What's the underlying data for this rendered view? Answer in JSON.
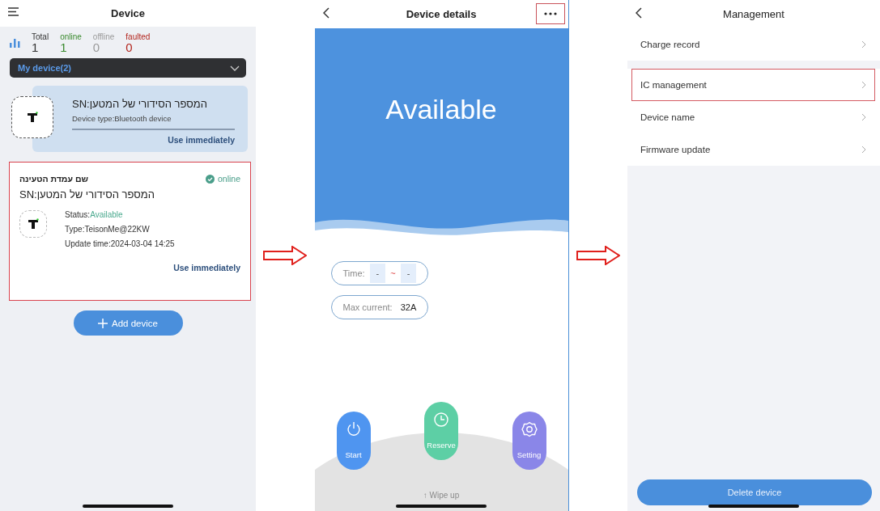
{
  "device_list": {
    "title": "Device",
    "stats": [
      {
        "label": "Total",
        "value": "1",
        "color": "#333333"
      },
      {
        "label": "online",
        "value": "1",
        "color": "#3a8a2e"
      },
      {
        "label": "offline",
        "value": "0",
        "color": "#9a9a9a"
      },
      {
        "label": "faulted",
        "value": "0",
        "color": "#b3261e"
      }
    ],
    "dropdown": {
      "label": "My device(2)"
    },
    "devices": [
      {
        "kind": "bluetooth",
        "sn": "SN:המספר הסידורי של המטען",
        "type": "Device type:Bluetooth device",
        "action": "Use immediately",
        "highlighted": false
      },
      {
        "kind": "charger",
        "name": "שם עמדת הטעינה",
        "badge": "online",
        "sn": "SN:המספר הסידורי של המטען",
        "status_label": "Status:",
        "status_value": "Available",
        "type": "Type:TeisonMe@22KW",
        "update": "Update time:2024-03-04 14:25",
        "action": "Use immediately",
        "highlighted": true
      }
    ],
    "add_button": "Add device"
  },
  "device_details": {
    "title": "Device details",
    "more_highlighted": true,
    "status": "Available",
    "time": {
      "label": "Time:",
      "start": "-",
      "separator": "~",
      "end": "-"
    },
    "max_current": {
      "label": "Max current:",
      "value": "32A"
    },
    "actions": [
      {
        "label": "Start",
        "kind": "power",
        "color": "#4f95f0"
      },
      {
        "label": "Reserve",
        "kind": "clock",
        "color": "#5dcfa5"
      },
      {
        "label": "Setting",
        "kind": "gear",
        "color": "#8a86e8"
      }
    ],
    "hint": "↑ Wipe up"
  },
  "management": {
    "title": "Management",
    "items": [
      {
        "label": "Charge record",
        "highlighted": false
      },
      {
        "label": "IC management",
        "highlighted": true
      },
      {
        "label": "Device name",
        "highlighted": false
      },
      {
        "label": "Firmware update",
        "highlighted": false
      }
    ],
    "delete_button": "Delete device"
  }
}
